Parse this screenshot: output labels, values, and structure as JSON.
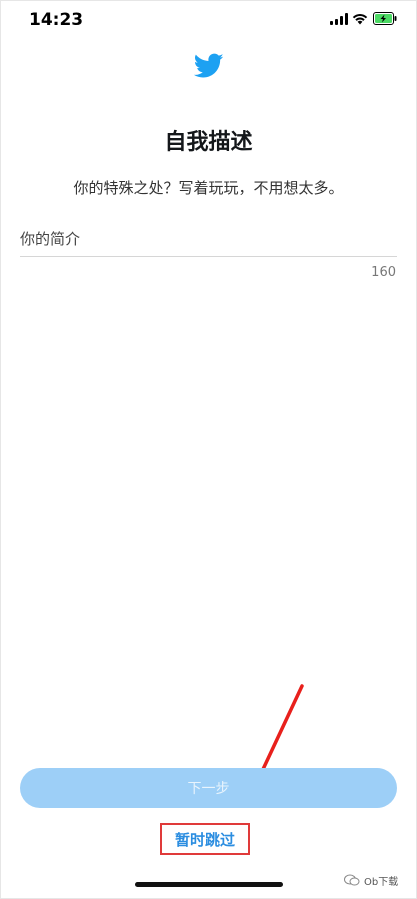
{
  "status_bar": {
    "time": "14:23"
  },
  "header": {
    "logo_icon": "twitter-bird-icon",
    "title": "自我描述",
    "subtitle": "你的特殊之处？写着玩玩，不用想太多。"
  },
  "bio": {
    "placeholder": "你的简介",
    "value": "",
    "remaining": "160"
  },
  "actions": {
    "next_label": "下一步",
    "skip_label": "暂时跳过"
  },
  "watermark": {
    "text": "Ob下载"
  },
  "colors": {
    "accent": "#1da1f2",
    "button_disabled": "#9dcff7",
    "highlight": "#e03a3a"
  }
}
